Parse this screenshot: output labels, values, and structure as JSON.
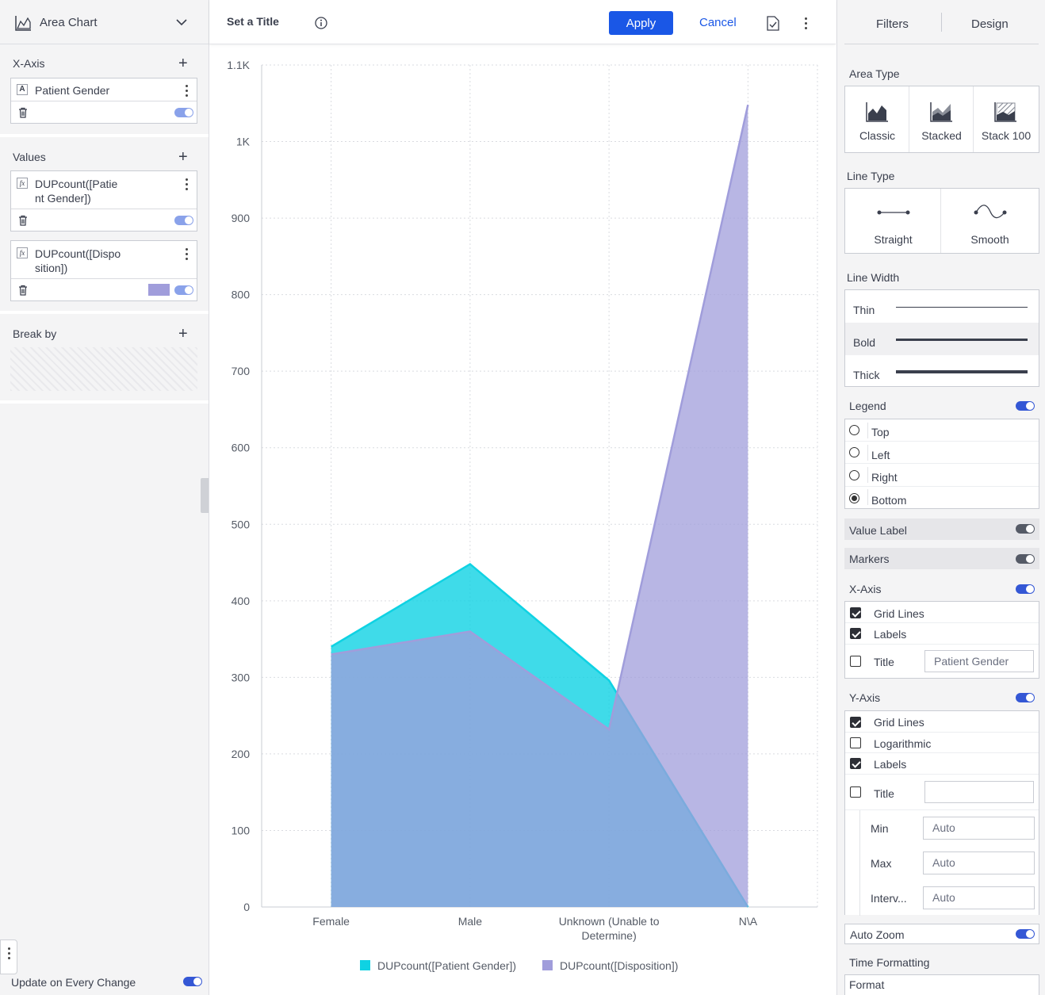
{
  "left_panel": {
    "chart_type": "Area Chart",
    "x_axis": {
      "title": "X-Axis",
      "field": "Patient Gender",
      "field_type_icon": "A"
    },
    "values": {
      "title": "Values",
      "items": [
        {
          "icon": "fx",
          "line1": "DUPcount([Patie",
          "line2": "nt Gender])"
        },
        {
          "icon": "fx",
          "line1": "DUPcount([Dispo",
          "line2": "sition])",
          "swatch": "#a09ddb"
        }
      ]
    },
    "break_by": {
      "title": "Break by"
    },
    "update_label": "Update on Every Change"
  },
  "toolbar": {
    "title": "Set a Title",
    "apply": "Apply",
    "cancel": "Cancel"
  },
  "chart_data": {
    "type": "area",
    "categories": [
      "Female",
      "Male",
      "Unknown (Unable to Determine)",
      "N\\A"
    ],
    "category_lines": [
      [
        "Female"
      ],
      [
        "Male"
      ],
      [
        "Unknown (Unable to",
        "Determine)"
      ],
      [
        "N\\A"
      ]
    ],
    "series": [
      {
        "name": "DUPcount([Patient Gender])",
        "values": [
          340,
          448,
          296,
          0
        ],
        "color": "#0fd2e3"
      },
      {
        "name": "DUPcount([Disposition])",
        "values": [
          330,
          360,
          232,
          1048
        ],
        "color": "#a09ddb"
      }
    ],
    "yticks": [
      "0",
      "100",
      "200",
      "300",
      "400",
      "500",
      "600",
      "700",
      "800",
      "900",
      "1K",
      "1.1K"
    ],
    "ylim": [
      0,
      1100
    ],
    "grid": true,
    "legend_position": "bottom"
  },
  "right_panel": {
    "tabs": [
      "Filters",
      "Design"
    ],
    "area_type": {
      "title": "Area Type",
      "options": [
        "Classic",
        "Stacked",
        "Stack 100"
      ]
    },
    "line_type": {
      "title": "Line Type",
      "options": [
        "Straight",
        "Smooth"
      ]
    },
    "line_width": {
      "title": "Line Width",
      "options": [
        "Thin",
        "Bold",
        "Thick"
      ],
      "selected": "Bold"
    },
    "legend": {
      "title": "Legend",
      "options": [
        "Top",
        "Left",
        "Right",
        "Bottom"
      ],
      "selected": "Bottom",
      "enabled": true
    },
    "value_label": {
      "title": "Value Label",
      "enabled": false
    },
    "markers": {
      "title": "Markers",
      "enabled": false
    },
    "x_axis": {
      "title": "X-Axis",
      "enabled": true,
      "grid_lines": "Grid Lines",
      "labels": "Labels",
      "title_label": "Title",
      "title_value": "Patient Gender"
    },
    "y_axis": {
      "title": "Y-Axis",
      "enabled": true,
      "grid_lines": "Grid Lines",
      "logarithmic": "Logarithmic",
      "labels": "Labels",
      "title_label": "Title",
      "title_value": "",
      "min_label": "Min",
      "min_value": "Auto",
      "max_label": "Max",
      "max_value": "Auto",
      "interval_label": "Interv...",
      "interval_value": "Auto"
    },
    "auto_zoom": {
      "title": "Auto Zoom",
      "enabled": true
    },
    "time_formatting": {
      "title": "Time Formatting",
      "format_label": "Format"
    }
  }
}
